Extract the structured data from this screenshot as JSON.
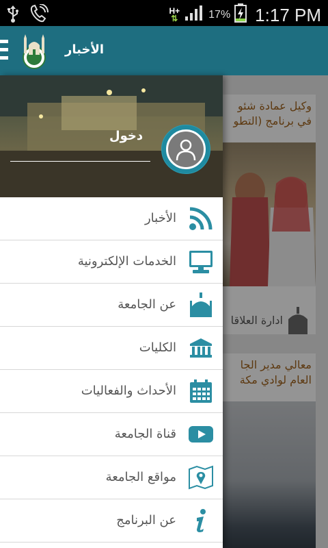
{
  "status_bar": {
    "network_type": "H+",
    "battery_percent": "17%",
    "time": "1:17 PM",
    "icons": [
      "usb-icon",
      "phone-call-icon",
      "data-arrows-icon",
      "signal-icon",
      "battery-charging-icon"
    ]
  },
  "app_bar": {
    "title": "الأخبار",
    "icons": [
      "menu-icon",
      "university-logo"
    ]
  },
  "drawer": {
    "login_label": "دخول",
    "avatar_icon": "user-avatar-icon",
    "items": [
      {
        "label": "الأخبار",
        "icon": "rss-icon"
      },
      {
        "label": "الخدمات الإلكترونية",
        "icon": "monitor-icon"
      },
      {
        "label": "عن الجامعة",
        "icon": "mosque-icon"
      },
      {
        "label": "الكليات",
        "icon": "building-icon"
      },
      {
        "label": "الأحداث والفعاليات",
        "icon": "calendar-icon"
      },
      {
        "label": "قناة الجامعة",
        "icon": "youtube-icon"
      },
      {
        "label": "مواقع الجامعة",
        "icon": "map-pin-icon"
      },
      {
        "label": "عن البرنامج",
        "icon": "info-icon"
      }
    ]
  },
  "news": {
    "cards": [
      {
        "title_line1": "وكيل عمادة شئو",
        "title_line2": "في برنامج (التطو",
        "footer": "ادارة العلاقا"
      },
      {
        "title_line1": "معالي مدير الجا",
        "title_line2": "العام لوادي مكة"
      }
    ]
  },
  "colors": {
    "primary": "#1e6e80",
    "icon_teal": "#2b8ea3",
    "news_title": "#a0621c"
  }
}
